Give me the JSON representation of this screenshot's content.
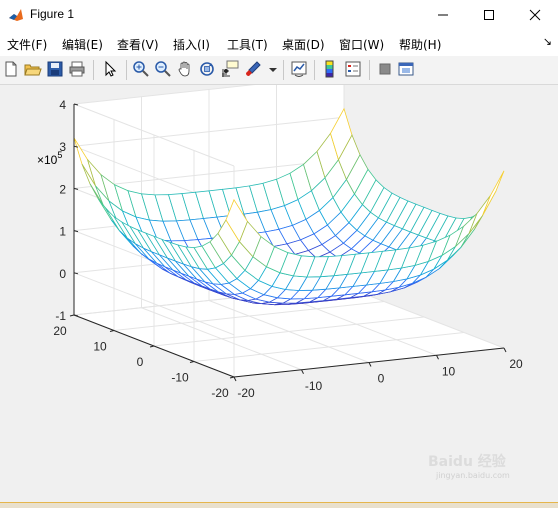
{
  "window": {
    "title": "Figure 1"
  },
  "menu": {
    "items": [
      "文件(F)",
      "编辑(E)",
      "查看(V)",
      "插入(I)",
      "工具(T)",
      "桌面(D)",
      "窗口(W)",
      "帮助(H)"
    ],
    "overflow": "↘"
  },
  "toolbar": {
    "buttons": [
      "new-figure",
      "open-file",
      "save",
      "print",
      "edit-plot",
      "zoom-in",
      "zoom-out",
      "pan",
      "rotate-3d",
      "data-cursor",
      "brush",
      "link-plot",
      "insert-colorbar",
      "insert-legend",
      "hide-plot-tools",
      "show-plot-tools"
    ]
  },
  "chart_data": {
    "type": "surface-mesh",
    "function": "z = x^4 + y^4 (approx)",
    "x_range": [
      -20,
      20
    ],
    "y_range": [
      -20,
      20
    ],
    "z_range": [
      -1,
      4
    ],
    "z_exponent": "×10",
    "z_exponent_power": "5",
    "x_ticks": [
      "-20",
      "-10",
      "0",
      "10",
      "20"
    ],
    "y_ticks": [
      "-20",
      "-10",
      "0",
      "10",
      "20"
    ],
    "z_ticks": [
      "-1",
      "0",
      "1",
      "2",
      "3",
      "4"
    ],
    "colormap": [
      "#3e26a8",
      "#2e6cf7",
      "#12aed8",
      "#3fc796",
      "#a0bd4e",
      "#f9d02f",
      "#f9fb15"
    ],
    "grid": true
  },
  "watermark": {
    "text": "Baidu 经验",
    "sub": "jingyan.baidu.com"
  }
}
